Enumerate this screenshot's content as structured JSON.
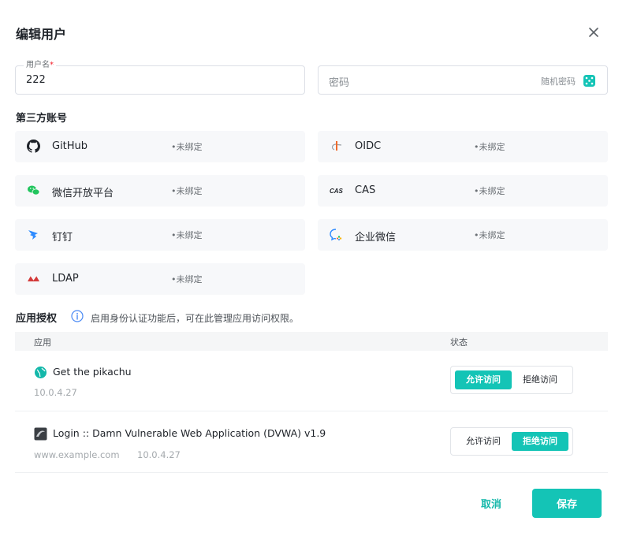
{
  "dialog": {
    "title": "编辑用户",
    "close_icon": "close-icon"
  },
  "form": {
    "username": {
      "label": "用户名",
      "required_mark": "*",
      "value": "222"
    },
    "password": {
      "placeholder": "密码",
      "random_label": "随机密码",
      "icon": "dice-icon"
    }
  },
  "third_party": {
    "title": "第三方账号",
    "accounts": [
      {
        "name": "GitHub",
        "status": "•未绑定",
        "icon": "github-icon"
      },
      {
        "name": "OIDC",
        "status": "•未绑定",
        "icon": "oidc-icon"
      },
      {
        "name": "微信开放平台",
        "status": "•未绑定",
        "icon": "wechat-icon"
      },
      {
        "name": "CAS",
        "status": "•未绑定",
        "icon": "cas-icon"
      },
      {
        "name": "钉钉",
        "status": "•未绑定",
        "icon": "dingtalk-icon"
      },
      {
        "name": "企业微信",
        "status": "•未绑定",
        "icon": "wecom-icon"
      },
      {
        "name": "LDAP",
        "status": "•未绑定",
        "icon": "ldap-icon"
      }
    ]
  },
  "app_auth": {
    "title": "应用授权",
    "info": "启用身份认证功能后，可在此管理应用访问权限。",
    "columns": {
      "app": "应用",
      "status": "状态"
    },
    "rows": [
      {
        "name": "Get the pikachu",
        "host": "",
        "ip": "10.0.4.27",
        "allow_label": "允许访问",
        "deny_label": "拒绝访问",
        "selected": "allow",
        "icon": "globe-icon"
      },
      {
        "name": "Login :: Damn Vulnerable Web Application (DVWA) v1.9",
        "host": "www.example.com",
        "ip": "10.0.4.27",
        "allow_label": "允许访问",
        "deny_label": "拒绝访问",
        "selected": "deny",
        "icon": "app-logo-icon"
      }
    ]
  },
  "footer": {
    "cancel_label": "取消",
    "save_label": "保存"
  },
  "colors": {
    "accent": "#14c4b6",
    "link": "#14b8aa",
    "github": "#1f2329",
    "oidc": "#f06a2b",
    "wechat": "#22c55e",
    "dingtalk": "#2e8bff",
    "wecom": "#2e8bff",
    "ldap": "#d33a3a"
  }
}
